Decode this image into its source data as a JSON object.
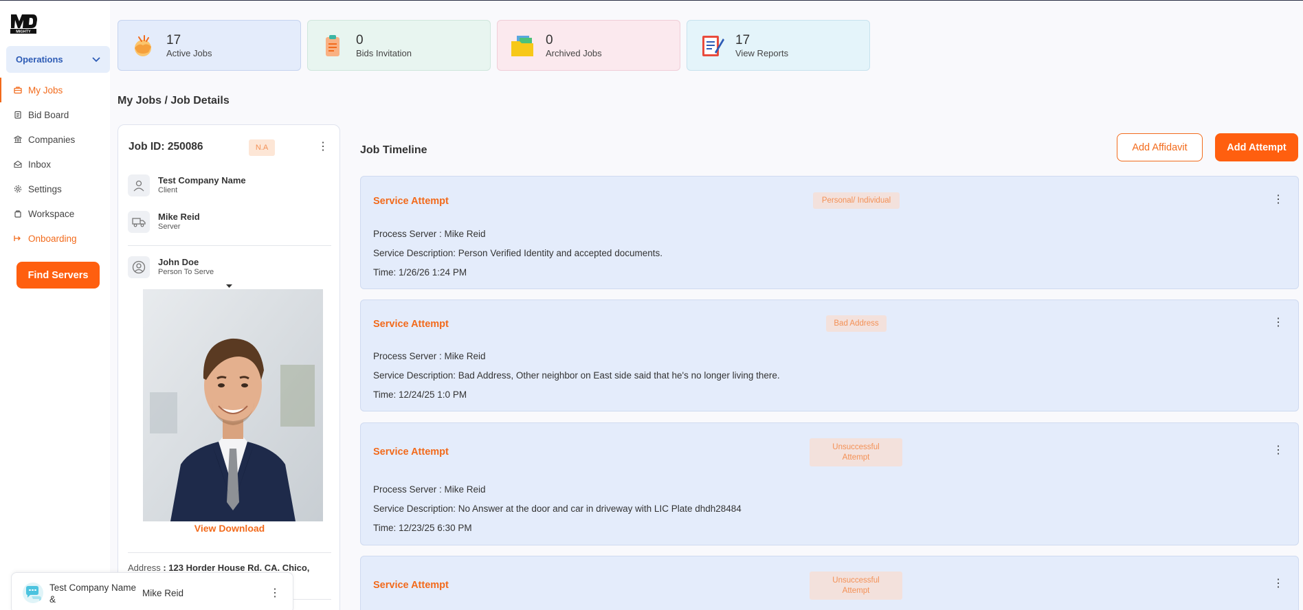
{
  "sidebar": {
    "logo_alt": "MD MIGHTY",
    "section_label": "Operations",
    "items": [
      {
        "label": "My Jobs",
        "icon": "briefcase-icon"
      },
      {
        "label": "Bid Board",
        "icon": "clipboard-icon"
      },
      {
        "label": "Companies",
        "icon": "bank-icon"
      },
      {
        "label": "Inbox",
        "icon": "envelope-icon"
      },
      {
        "label": "Settings",
        "icon": "gear-icon"
      },
      {
        "label": "Workspace",
        "icon": "bag-icon"
      },
      {
        "label": "Onboarding",
        "icon": "login-arrow-icon"
      }
    ],
    "find_servers": "Find Servers"
  },
  "stats": [
    {
      "value": "17",
      "label": "Active Jobs",
      "bg": "#e4ecfb",
      "border": "#c5d3ef"
    },
    {
      "value": "0",
      "label": "Bids Invitation",
      "bg": "#e8f5f0",
      "border": "#cfe6dc"
    },
    {
      "value": "0",
      "label": "Archived Jobs",
      "bg": "#fbe9ee",
      "border": "#f0cdd7"
    },
    {
      "value": "17",
      "label": "View Reports",
      "bg": "#e4f4fa",
      "border": "#c7e2ee"
    }
  ],
  "breadcrumb": "My Jobs / Job Details",
  "job": {
    "id_label": "Job ID: 250086",
    "badge": "N.A",
    "client_name": "Test Company Name",
    "client_role": "Client",
    "server_name": "Mike Reid",
    "server_role": "Server",
    "serve_name": "John Doe",
    "serve_role": "Person To Serve",
    "view_download": "View Download",
    "address_label": "Address",
    "address_value": ": 123 Horder House Rd. CA. Chico,"
  },
  "timeline": {
    "title": "Job Timeline",
    "add_affidavit": "Add Affidavit",
    "add_attempt": "Add Attempt",
    "attempts": [
      {
        "title": "Service Attempt",
        "badge": "Personal/ Individual",
        "server": "Process Server : Mike Reid",
        "description": "Service Description: Person Verified Identity and accepted documents.",
        "time": "Time: 1/26/26 1:24 PM"
      },
      {
        "title": "Service Attempt",
        "badge": "Bad Address",
        "server": "Process Server : Mike Reid",
        "description": "Service Description: Bad Address, Other neighbor on East side said that he's no longer living there.",
        "time": "Time: 12/24/25 1:0 PM"
      },
      {
        "title": "Service Attempt",
        "badge": "Unsuccessful Attempt",
        "server": "Process Server : Mike Reid",
        "description": "Service Description: No Answer at the door and car in driveway with LIC Plate dhdh28484",
        "time": "Time: 12/23/25 6:30 PM"
      },
      {
        "title": "Service Attempt",
        "badge": "Unsuccessful Attempt"
      }
    ]
  },
  "chat": {
    "company_line1": "Test Company Name",
    "company_line2": "&",
    "name": "Mike Reid"
  },
  "colors": {
    "accent": "#ff5f0f",
    "accent_text": "#f26a1b",
    "attempt_bg": "#e4ecfb"
  }
}
